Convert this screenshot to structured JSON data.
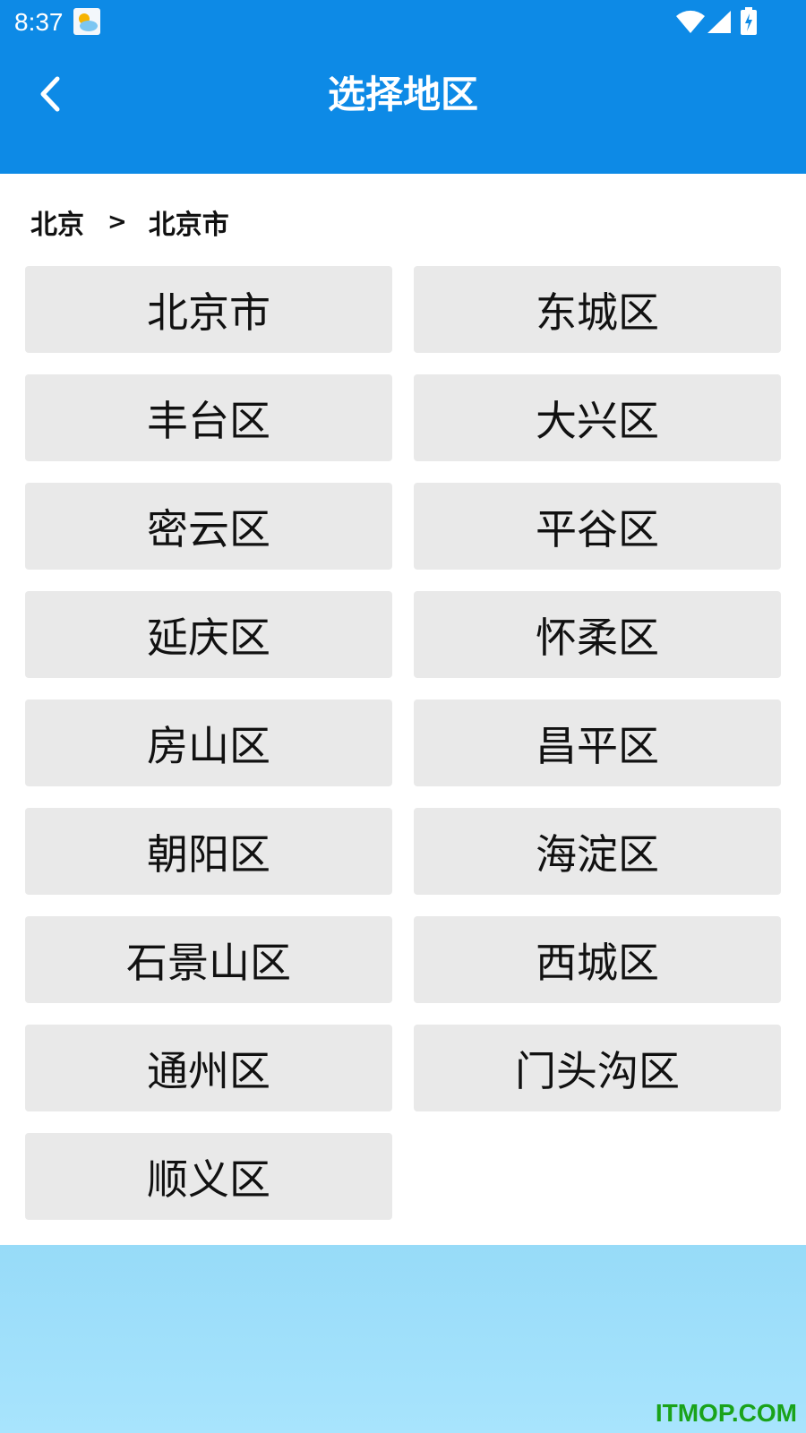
{
  "status_bar": {
    "time": "8:37",
    "icons": [
      "weather-icon",
      "wifi-icon",
      "signal-icon",
      "battery-icon"
    ]
  },
  "header": {
    "title": "选择地区",
    "back_icon": "chevron-left-icon",
    "background": "#0d8ae6"
  },
  "breadcrumb": {
    "level1": "北京",
    "separator": ">",
    "level2": "北京市"
  },
  "regions": [
    "北京市",
    "东城区",
    "丰台区",
    "大兴区",
    "密云区",
    "平谷区",
    "延庆区",
    "怀柔区",
    "房山区",
    "昌平区",
    "朝阳区",
    "海淀区",
    "石景山区",
    "西城区",
    "通州区",
    "门头沟区",
    "顺义区"
  ],
  "watermark": "ITMOP.COM",
  "colors": {
    "cell_background": "#e9e9e9",
    "footer": "#a8e4fd",
    "watermark": "#1aa31a"
  }
}
